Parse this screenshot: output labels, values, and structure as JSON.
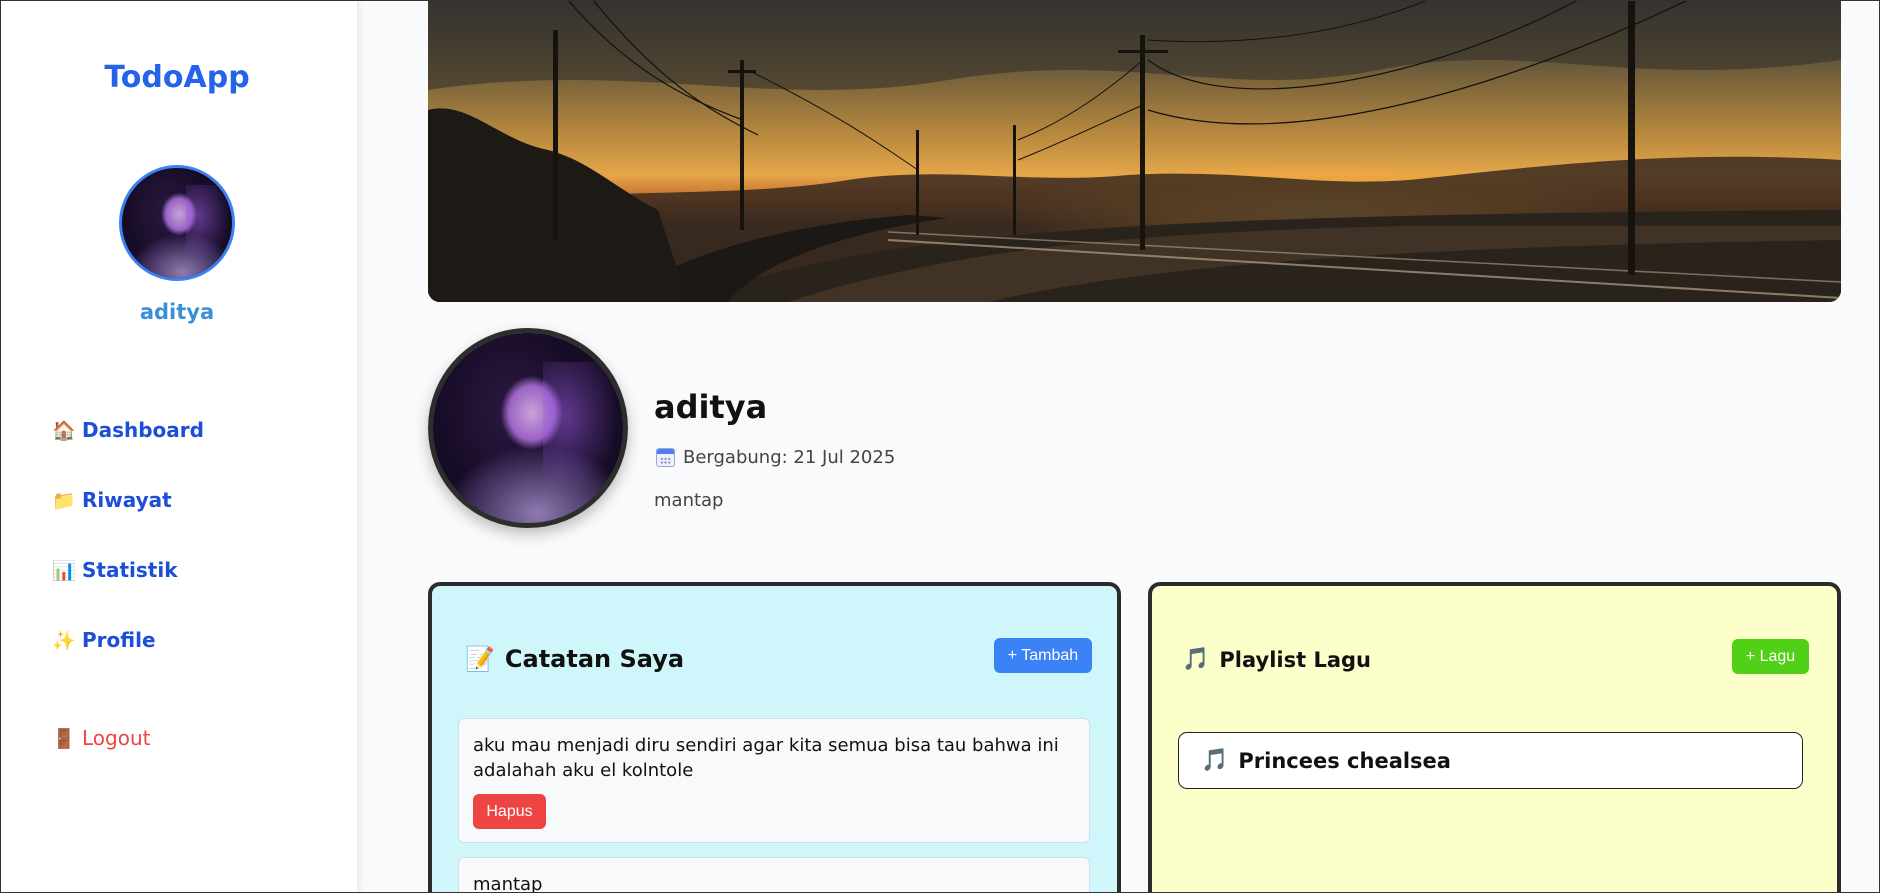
{
  "sidebar": {
    "brand": "TodoApp",
    "username": "aditya",
    "nav": [
      {
        "icon": "🏠",
        "label": "Dashboard"
      },
      {
        "icon": "📁",
        "label": "Riwayat"
      },
      {
        "icon": "📊",
        "label": "Statistik"
      },
      {
        "icon": "✨",
        "label": "Profile"
      }
    ],
    "logout": {
      "icon": "🚪",
      "label": "Logout"
    }
  },
  "profile": {
    "name": "aditya",
    "joined": "Bergabung: 21 Jul 2025",
    "bio": "mantap"
  },
  "notes_card": {
    "icon": "📝",
    "title": "Catatan Saya",
    "add_label": "+ Tambah",
    "notes": [
      {
        "text": "aku mau menjadi diru sendiri agar kita semua bisa tau bahwa ini adalahah aku el kolntole",
        "delete_label": "Hapus"
      },
      {
        "text": "mantap"
      }
    ]
  },
  "playlist_card": {
    "icon": "🎵",
    "title": "Playlist Lagu",
    "add_label": "+ Lagu",
    "songs": [
      {
        "icon": "🎵",
        "title": "Princees chealsea"
      }
    ]
  },
  "colors": {
    "brand": "#2563eb",
    "notes_bg": "#cff7fb",
    "playlist_bg": "#fdffca",
    "add_note_button": "#3b82f6",
    "add_song_button": "#52d017",
    "delete_button": "#ef4444",
    "logout": "#ef4444"
  }
}
